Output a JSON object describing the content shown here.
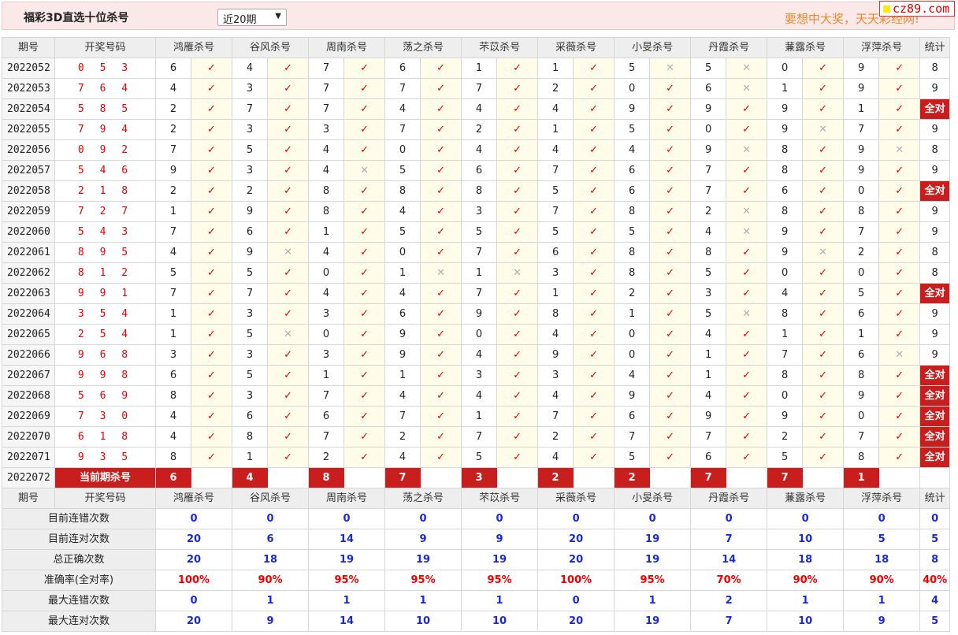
{
  "header": {
    "title": "福彩3D直选十位杀号",
    "period_select": "近20期",
    "slogan": "要想中大奖，天天彩经网!",
    "logo": "cz89.com"
  },
  "columns": {
    "period": "期号",
    "winning": "开奖号码",
    "experts": [
      "鸿雁杀号",
      "谷风杀号",
      "周南杀号",
      "荡之杀号",
      "芣苡杀号",
      "采薇杀号",
      "小旻杀号",
      "丹霞杀号",
      "蒹露杀号",
      "浮萍杀号"
    ],
    "stats": "统计"
  },
  "rows": [
    {
      "period": "2022052",
      "winning": "0 5 3",
      "kills": [
        "6",
        "4",
        "7",
        "6",
        "1",
        "1",
        "5",
        "5",
        "0",
        "9"
      ],
      "marks": [
        1,
        1,
        1,
        1,
        1,
        1,
        0,
        0,
        1,
        1
      ],
      "stat": "8"
    },
    {
      "period": "2022053",
      "winning": "7 6 4",
      "kills": [
        "4",
        "3",
        "7",
        "7",
        "7",
        "2",
        "0",
        "6",
        "1",
        "9"
      ],
      "marks": [
        1,
        1,
        1,
        1,
        1,
        1,
        1,
        0,
        1,
        1
      ],
      "stat": "9"
    },
    {
      "period": "2022054",
      "winning": "5 8 5",
      "kills": [
        "2",
        "7",
        "7",
        "4",
        "4",
        "4",
        "9",
        "9",
        "9",
        "1"
      ],
      "marks": [
        1,
        1,
        1,
        1,
        1,
        1,
        1,
        1,
        1,
        1
      ],
      "stat": "全对"
    },
    {
      "period": "2022055",
      "winning": "7 9 4",
      "kills": [
        "2",
        "3",
        "3",
        "7",
        "2",
        "1",
        "5",
        "0",
        "9",
        "7"
      ],
      "marks": [
        1,
        1,
        1,
        1,
        1,
        1,
        1,
        1,
        0,
        1
      ],
      "stat": "9"
    },
    {
      "period": "2022056",
      "winning": "0 9 2",
      "kills": [
        "7",
        "5",
        "4",
        "0",
        "4",
        "4",
        "4",
        "9",
        "8",
        "9"
      ],
      "marks": [
        1,
        1,
        1,
        1,
        1,
        1,
        1,
        0,
        1,
        0
      ],
      "stat": "8"
    },
    {
      "period": "2022057",
      "winning": "5 4 6",
      "kills": [
        "9",
        "3",
        "4",
        "5",
        "6",
        "7",
        "6",
        "7",
        "8",
        "9"
      ],
      "marks": [
        1,
        1,
        0,
        1,
        1,
        1,
        1,
        1,
        1,
        1
      ],
      "stat": "9"
    },
    {
      "period": "2022058",
      "winning": "2 1 8",
      "kills": [
        "2",
        "2",
        "8",
        "8",
        "8",
        "5",
        "6",
        "7",
        "6",
        "0"
      ],
      "marks": [
        1,
        1,
        1,
        1,
        1,
        1,
        1,
        1,
        1,
        1
      ],
      "stat": "全对"
    },
    {
      "period": "2022059",
      "winning": "7 2 7",
      "kills": [
        "1",
        "9",
        "8",
        "4",
        "3",
        "7",
        "8",
        "2",
        "8",
        "8"
      ],
      "marks": [
        1,
        1,
        1,
        1,
        1,
        1,
        1,
        0,
        1,
        1
      ],
      "stat": "9"
    },
    {
      "period": "2022060",
      "winning": "5 4 3",
      "kills": [
        "7",
        "6",
        "1",
        "5",
        "5",
        "5",
        "5",
        "4",
        "9",
        "7"
      ],
      "marks": [
        1,
        1,
        1,
        1,
        1,
        1,
        1,
        0,
        1,
        1
      ],
      "stat": "9"
    },
    {
      "period": "2022061",
      "winning": "8 9 5",
      "kills": [
        "4",
        "9",
        "4",
        "0",
        "7",
        "6",
        "8",
        "8",
        "9",
        "2"
      ],
      "marks": [
        1,
        0,
        1,
        1,
        1,
        1,
        1,
        1,
        0,
        1
      ],
      "stat": "8"
    },
    {
      "period": "2022062",
      "winning": "8 1 2",
      "kills": [
        "5",
        "5",
        "0",
        "1",
        "1",
        "3",
        "8",
        "5",
        "0",
        "0"
      ],
      "marks": [
        1,
        1,
        1,
        0,
        0,
        1,
        1,
        1,
        1,
        1
      ],
      "stat": "8"
    },
    {
      "period": "2022063",
      "winning": "9 9 1",
      "kills": [
        "7",
        "7",
        "4",
        "4",
        "7",
        "1",
        "2",
        "3",
        "4",
        "5"
      ],
      "marks": [
        1,
        1,
        1,
        1,
        1,
        1,
        1,
        1,
        1,
        1
      ],
      "stat": "全对"
    },
    {
      "period": "2022064",
      "winning": "3 5 4",
      "kills": [
        "1",
        "3",
        "3",
        "6",
        "9",
        "8",
        "1",
        "5",
        "8",
        "6"
      ],
      "marks": [
        1,
        1,
        1,
        1,
        1,
        1,
        1,
        0,
        1,
        1
      ],
      "stat": "9"
    },
    {
      "period": "2022065",
      "winning": "2 5 4",
      "kills": [
        "1",
        "5",
        "0",
        "9",
        "0",
        "4",
        "0",
        "4",
        "1",
        "1"
      ],
      "marks": [
        1,
        0,
        1,
        1,
        1,
        1,
        1,
        1,
        1,
        1
      ],
      "stat": "9"
    },
    {
      "period": "2022066",
      "winning": "9 6 8",
      "kills": [
        "3",
        "3",
        "3",
        "9",
        "4",
        "9",
        "0",
        "1",
        "7",
        "6"
      ],
      "marks": [
        1,
        1,
        1,
        1,
        1,
        1,
        1,
        1,
        1,
        0
      ],
      "stat": "9"
    },
    {
      "period": "2022067",
      "winning": "9 9 8",
      "kills": [
        "6",
        "5",
        "1",
        "1",
        "3",
        "3",
        "4",
        "1",
        "8",
        "8"
      ],
      "marks": [
        1,
        1,
        1,
        1,
        1,
        1,
        1,
        1,
        1,
        1
      ],
      "stat": "全对"
    },
    {
      "period": "2022068",
      "winning": "5 6 9",
      "kills": [
        "8",
        "3",
        "7",
        "4",
        "4",
        "4",
        "9",
        "4",
        "0",
        "9"
      ],
      "marks": [
        1,
        1,
        1,
        1,
        1,
        1,
        1,
        1,
        1,
        1
      ],
      "stat": "全对"
    },
    {
      "period": "2022069",
      "winning": "7 3 0",
      "kills": [
        "4",
        "6",
        "6",
        "7",
        "1",
        "7",
        "6",
        "9",
        "9",
        "0"
      ],
      "marks": [
        1,
        1,
        1,
        1,
        1,
        1,
        1,
        1,
        1,
        1
      ],
      "stat": "全对"
    },
    {
      "period": "2022070",
      "winning": "6 1 8",
      "kills": [
        "4",
        "8",
        "7",
        "2",
        "7",
        "2",
        "7",
        "7",
        "2",
        "7"
      ],
      "marks": [
        1,
        1,
        1,
        1,
        1,
        1,
        1,
        1,
        1,
        1
      ],
      "stat": "全对"
    },
    {
      "period": "2022071",
      "winning": "9 3 5",
      "kills": [
        "8",
        "1",
        "2",
        "4",
        "5",
        "4",
        "5",
        "6",
        "5",
        "8"
      ],
      "marks": [
        1,
        1,
        1,
        1,
        1,
        1,
        1,
        1,
        1,
        1
      ],
      "stat": "全对"
    }
  ],
  "current": {
    "period": "2022072",
    "label": "当前期杀号",
    "kills": [
      "6",
      "4",
      "8",
      "7",
      "3",
      "2",
      "2",
      "7",
      "7",
      "1"
    ]
  },
  "marks": {
    "tick": "✓",
    "cross": "✕"
  },
  "stats": [
    {
      "label": "目前连错次数",
      "values": [
        "0",
        "0",
        "0",
        "0",
        "0",
        "0",
        "0",
        "0",
        "0",
        "0"
      ],
      "total": "0",
      "style": "blue"
    },
    {
      "label": "目前连对次数",
      "values": [
        "20",
        "6",
        "14",
        "9",
        "9",
        "20",
        "19",
        "7",
        "10",
        "5"
      ],
      "total": "5",
      "style": "blue"
    },
    {
      "label": "总正确次数",
      "values": [
        "20",
        "18",
        "19",
        "19",
        "19",
        "20",
        "19",
        "14",
        "18",
        "18"
      ],
      "total": "8",
      "style": "blue"
    },
    {
      "label": "准确率(全对率)",
      "values": [
        "100%",
        "90%",
        "95%",
        "95%",
        "95%",
        "100%",
        "95%",
        "70%",
        "90%",
        "90%"
      ],
      "total": "40%",
      "style": "red"
    },
    {
      "label": "最大连错次数",
      "values": [
        "0",
        "1",
        "1",
        "1",
        "1",
        "0",
        "1",
        "2",
        "1",
        "1"
      ],
      "total": "4",
      "style": "blue"
    },
    {
      "label": "最大连对次数",
      "values": [
        "20",
        "9",
        "14",
        "10",
        "10",
        "20",
        "19",
        "7",
        "10",
        "9"
      ],
      "total": "5",
      "style": "blue"
    }
  ],
  "colors": {
    "accent": "#c81e1e",
    "tick": "#e60000",
    "cross": "#b0b0b0",
    "stat_blue": "#1a2ad0",
    "header_bg": "#fbe9e9",
    "mark_bg": "#fffdea"
  }
}
